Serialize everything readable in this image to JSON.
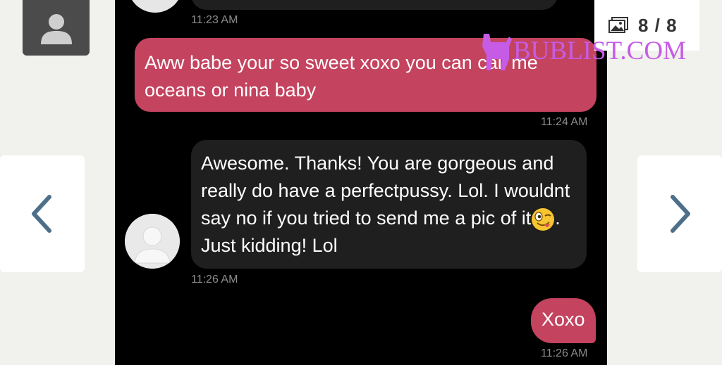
{
  "gallery": {
    "counter": "8 / 8",
    "prev_icon": "chevron-left-icon",
    "next_icon": "chevron-right-icon",
    "gallery_icon": "image-gallery-icon",
    "user_icon": "user-silhouette-icon"
  },
  "watermark": {
    "text": "BUBLIST.COM"
  },
  "messages": [
    {
      "direction": "incoming",
      "text": "",
      "time": "11:23 AM"
    },
    {
      "direction": "outgoing",
      "text": "Aww babe your so sweet xoxo you can call me oceans or nina baby",
      "time": "11:24 AM"
    },
    {
      "direction": "incoming",
      "text_before_emoji": "Awesome. Thanks! You are gorgeous and really do have a perfectpussy. Lol. I wouldnt say no if you tried to send me a pic of it",
      "emoji": "winking-face-with-tongue",
      "text_after_emoji": ". Just kidding! Lol",
      "time": "11:26 AM"
    },
    {
      "direction": "outgoing",
      "text": "Xoxo",
      "time": "11:26 AM"
    }
  ],
  "colors": {
    "outgoing_bubble": "#c4435f",
    "incoming_bubble": "#1f1f1f",
    "chat_background": "#000000",
    "page_background": "#f1f1ee",
    "nav_arrow": "#4d6f8a",
    "watermark": "#c65ce6"
  }
}
